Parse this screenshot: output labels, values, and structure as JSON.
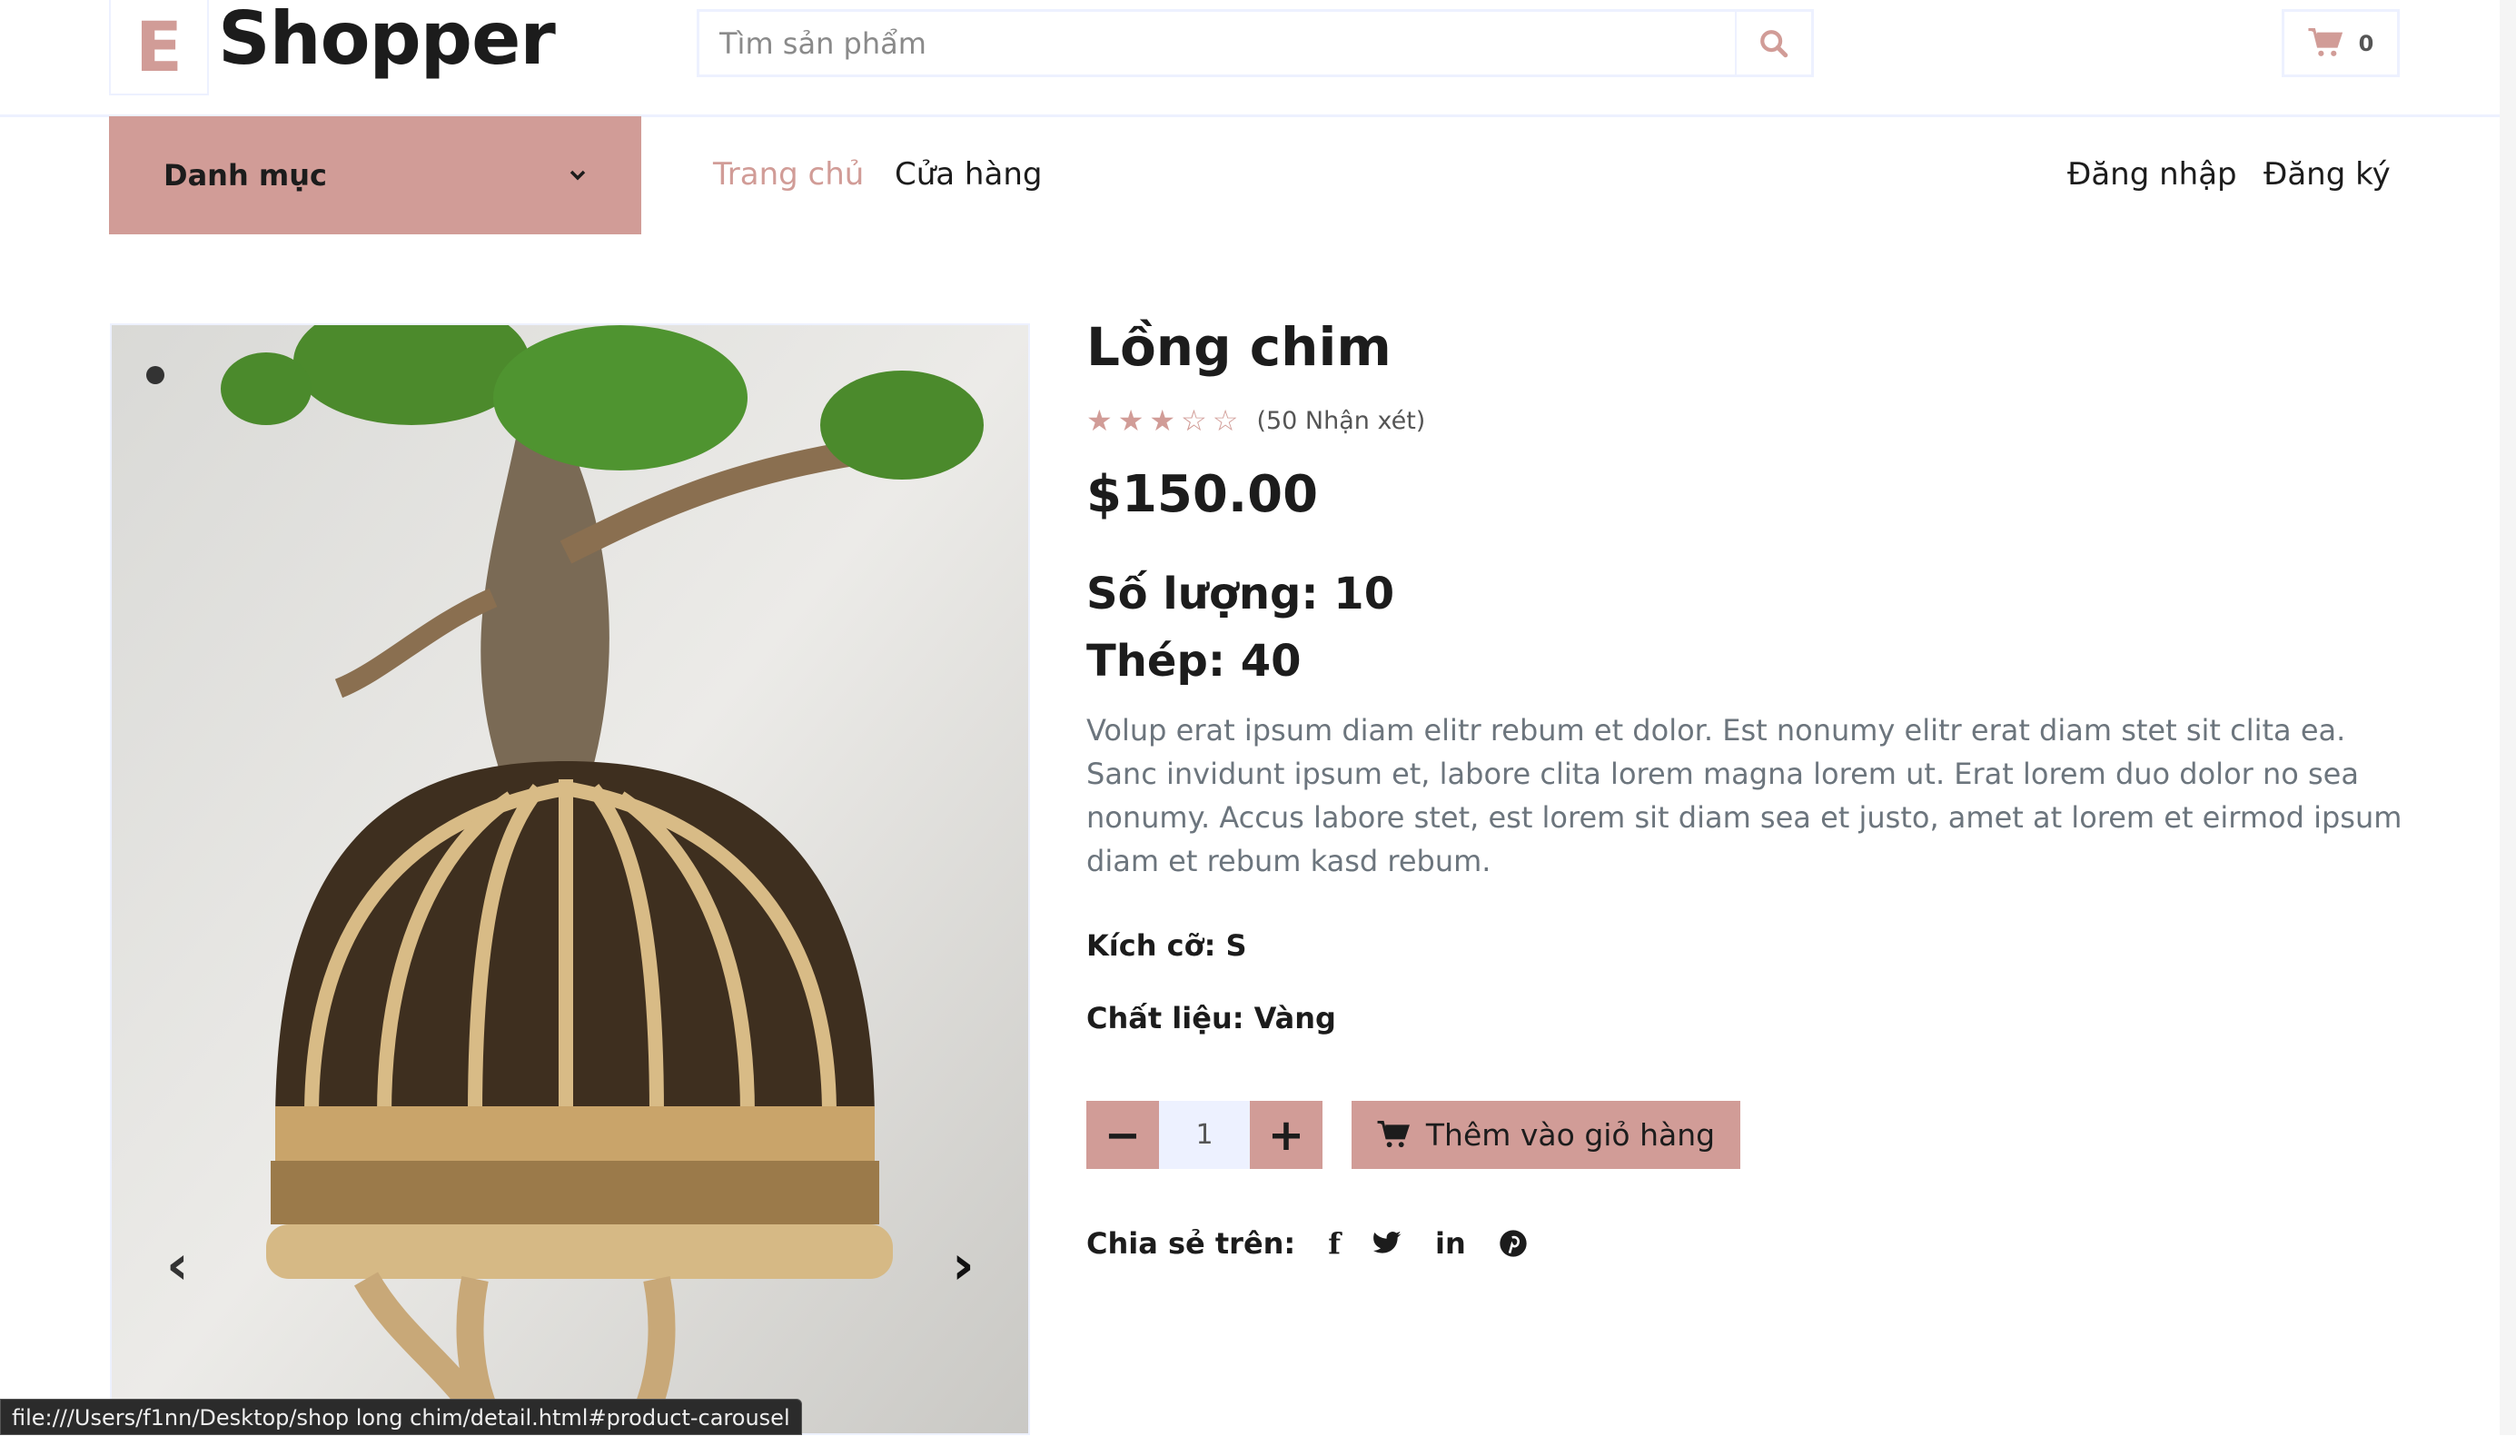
{
  "brand": {
    "logo_letter": "E",
    "name": "Shopper",
    "accent": "#D19C97"
  },
  "search": {
    "placeholder": "Tìm sản phẩm",
    "icon": "search-icon"
  },
  "cart": {
    "icon": "shopping-cart-icon",
    "count": "0"
  },
  "nav": {
    "categories_label": "Danh mục",
    "links": [
      "Trang chủ",
      "Cửa hàng"
    ],
    "login": "Đăng nhập",
    "register": "Đăng ký"
  },
  "product": {
    "title": "Lồng chim",
    "rating": 3.5,
    "rating_max": 5,
    "reviews": "(50 Nhận xét)",
    "price": "$150.00",
    "quantity_line": "Số lượng: 10",
    "steel_line": "Thép: 40",
    "description": "Volup erat ipsum diam elitr rebum et dolor. Est nonumy elitr erat diam stet sit clita ea. Sanc invidunt ipsum et, labore clita lorem magna lorem ut. Erat lorem duo dolor no sea nonumy. Accus labore stet, est lorem sit diam sea et justo, amet at lorem et eirmod ipsum diam et rebum kasd rebum.",
    "size": "Kích cỡ: S",
    "material": "Chất liệu: Vàng",
    "qty_value": "1",
    "add_to_cart": "Thêm vào giỏ hàng",
    "share_label": "Chia sẻ trên:",
    "share_icons": [
      "facebook-icon",
      "twitter-icon",
      "linkedin-icon",
      "pinterest-icon"
    ]
  },
  "status_bar": "file:///Users/f1nn/Desktop/shop long chim/detail.html#product-carousel"
}
